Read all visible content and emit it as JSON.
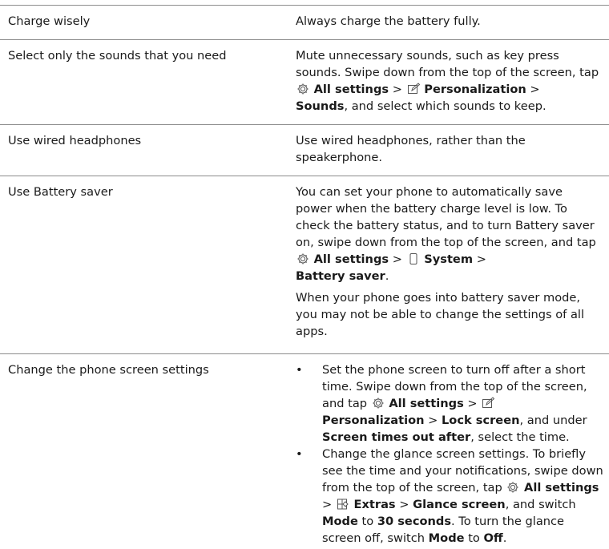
{
  "rows": [
    {
      "tip": "Charge wisely",
      "desc": "Always charge the battery fully."
    },
    {
      "tip": "Select only the sounds that you need",
      "desc_parts": {
        "a": "Mute unnecessary sounds, such as key press sounds. Swipe down from the top of the screen, tap",
        "all_settings": "All settings",
        "sep1": ">",
        "personalization": "Personalization",
        "sep2": ">",
        "sounds": "Sounds",
        "b": ", and select which sounds to keep."
      }
    },
    {
      "tip": "Use wired headphones",
      "desc": "Use wired headphones, rather than the speakerphone."
    },
    {
      "tip": "Use Battery saver",
      "desc_parts": {
        "a": "You can set your phone to automatically save power when the battery charge level is low. To check the battery status, and to turn Battery saver on, swipe down from the top of the screen, and tap",
        "all_settings": "All settings",
        "sep1": ">",
        "system": "System",
        "sep2": ">",
        "battery_saver": "Battery saver",
        "end": "."
      },
      "desc2": "When your phone goes into battery saver mode, you may not be able to change the settings of all apps."
    },
    {
      "tip": "Change the phone screen settings",
      "bullet": "•",
      "bullets": [
        {
          "a": "Set the phone screen to turn off after a short time. Swipe down from the top of the screen, and tap",
          "all_settings": "All settings",
          "sep1": ">",
          "personalization": "Personalization",
          "sep2": ">",
          "lock_screen": "Lock screen",
          "b": ", and under",
          "timeout": "Screen times out after",
          "c": ", select the time."
        },
        {
          "a": "Change the glance screen settings. To briefly see the time and your notifications, swipe down from the top of the screen, tap",
          "all_settings": "All settings",
          "sep1": ">",
          "extras": "Extras",
          "sep2": ">",
          "glance": "Glance screen",
          "b": ", and switch",
          "mode": "Mode",
          "to": "to",
          "thirty": "30 seconds",
          "c": ". To turn the glance screen off, switch",
          "mode2": "Mode",
          "to2": "to",
          "off": "Off",
          "end": "."
        }
      ]
    }
  ],
  "icons": {
    "settings": "gear-icon",
    "personalization": "pencil-edit-icon",
    "system": "phone-icon",
    "extras": "extras-icon"
  },
  "colors": {
    "divider": "#8c8c8c",
    "text": "#1a1a1a"
  }
}
